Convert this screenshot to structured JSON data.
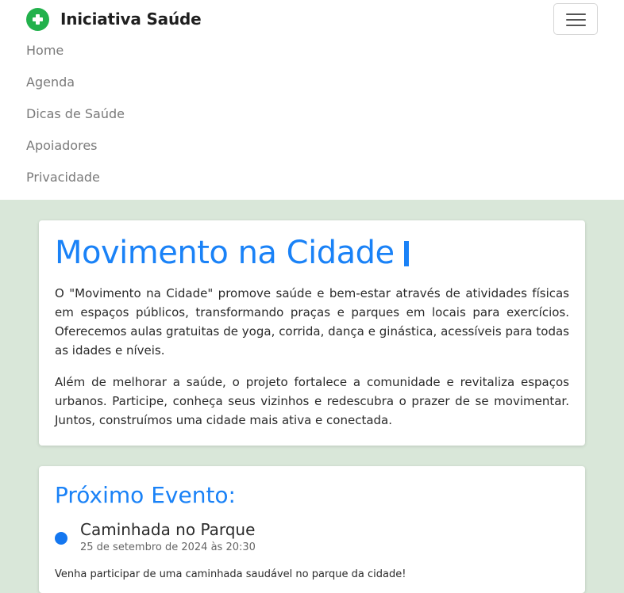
{
  "header": {
    "brand_name": "Iniciativa Saúde",
    "brand_icon": "plus-circle-icon",
    "brand_color": "#22b14c",
    "menu_icon": "hamburger-menu-icon",
    "nav_links": [
      "Home",
      "Agenda",
      "Dicas de Saúde",
      "Apoiadores",
      "Privacidade"
    ]
  },
  "hero": {
    "title": "Movimento na Cidade",
    "paragraphs": [
      "O \"Movimento na Cidade\" promove saúde e bem-estar através de atividades físicas em espaços públicos, transformando praças e parques em locais para exercícios. Oferecemos aulas gratuitas de yoga, corrida, dança e ginástica, acessíveis para todas as idades e níveis.",
      "Além de melhorar a saúde, o projeto fortalece a comunidade e revitaliza espaços urbanos. Participe, conheça seus vizinhos e redescubra o prazer de se movimentar. Juntos, construímos uma cidade mais ativa e conectada."
    ]
  },
  "event": {
    "section_title": "Próximo Evento:",
    "name": "Caminhada no Parque",
    "date": "25 de setembro de 2024 às 20:30",
    "description": "Venha participar de uma caminhada saudável no parque da cidade!"
  },
  "colors": {
    "accent": "#1a82f7",
    "page_background": "#d9e7d9",
    "nav_text": "#7a7a7a"
  }
}
